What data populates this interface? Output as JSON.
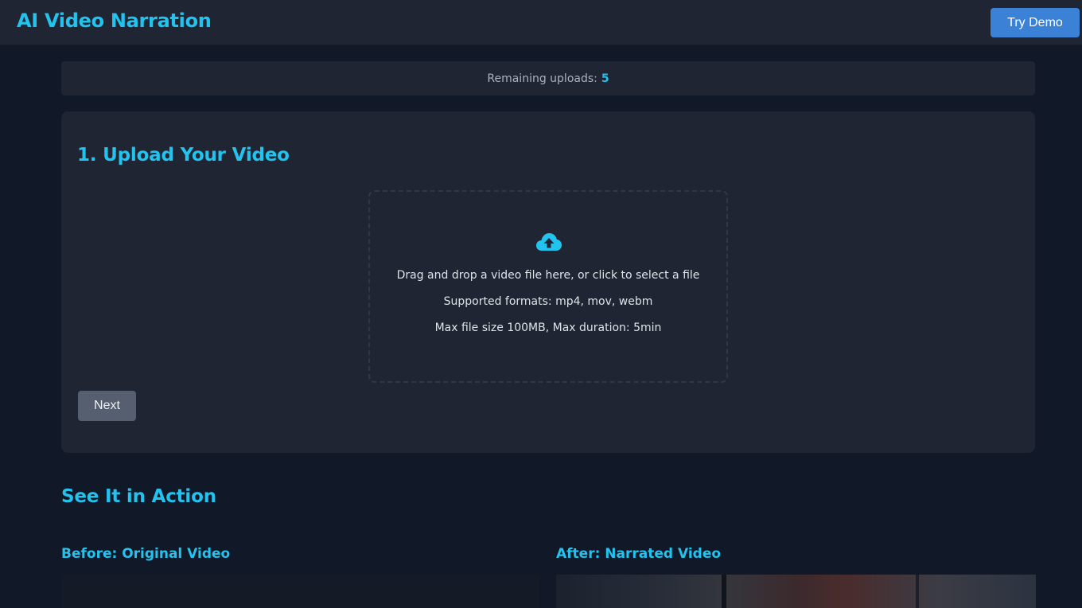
{
  "header": {
    "title": "AI Video Narration",
    "try_demo_label": "Try Demo"
  },
  "uploads": {
    "label": "Remaining uploads:",
    "count": "5"
  },
  "upload_step": {
    "title": "1. Upload Your Video",
    "icon": "cloud-upload-icon",
    "drop_text": "Drag and drop a video file here, or click to select a file",
    "formats_text": "Supported formats: mp4, mov, webm",
    "limits_text": "Max file size 100MB, Max duration: 5min",
    "next_label": "Next"
  },
  "demo": {
    "title": "See It in Action",
    "before_label": "Before: Original Video",
    "after_label": "After: Narrated Video"
  },
  "colors": {
    "accent": "#22c3ee",
    "primary_button": "#3b82d6",
    "disabled_button": "#565f6f",
    "background": "#111827",
    "card": "#1f2533"
  }
}
